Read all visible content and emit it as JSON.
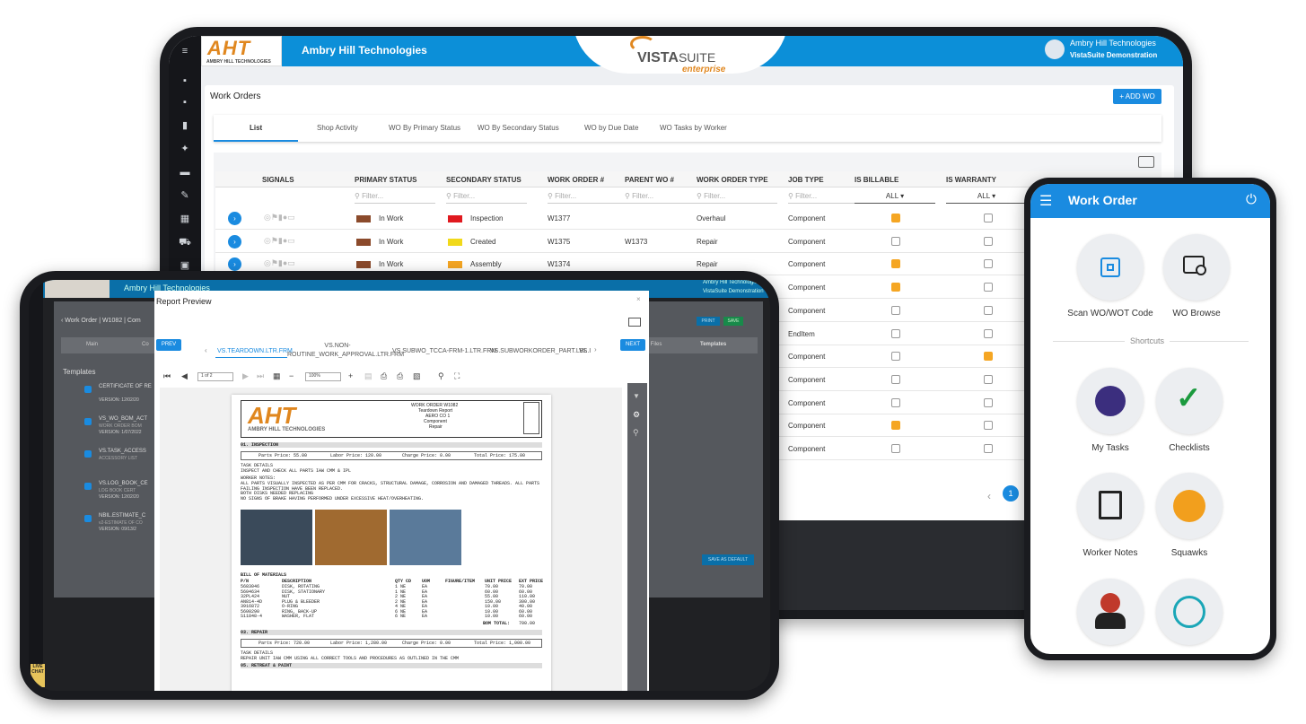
{
  "main": {
    "company": "Ambry Hill Technologies",
    "logo_text": "AHT",
    "logo_sub": "AMBRY HILL TECHNOLOGIES",
    "brand": {
      "vista": "VISTA",
      "suite": "SUITE",
      "enterprise": "enterprise"
    },
    "user": {
      "name": "Ambry Hill Technologies",
      "sub": "VistaSuite Demonstration"
    },
    "page_title": "Work Orders",
    "add_button": "+ ADD WO",
    "tabs": [
      "List",
      "Shop Activity",
      "WO By Primary Status",
      "WO By Secondary Status",
      "WO by Due Date",
      "WO Tasks by Worker"
    ],
    "columns": [
      "SIGNALS",
      "PRIMARY STATUS",
      "SECONDARY STATUS",
      "WORK ORDER #",
      "PARENT WO #",
      "WORK ORDER TYPE",
      "JOB TYPE",
      "IS BILLABLE",
      "IS WARRANTY"
    ],
    "filter_placeholder": "Filter...",
    "all_label": "ALL",
    "rows": [
      {
        "primary": "In Work",
        "secondary": "Inspection",
        "wo": "W1377",
        "parent": "",
        "type": "Overhaul",
        "job": "Component",
        "sec_color": "#e0191f",
        "billable": true,
        "warranty": false
      },
      {
        "primary": "In Work",
        "secondary": "Created",
        "wo": "W1375",
        "parent": "W1373",
        "type": "Repair",
        "job": "Component",
        "sec_color": "#f1d91a",
        "billable": false,
        "warranty": false
      },
      {
        "primary": "In Work",
        "secondary": "Assembly",
        "wo": "W1374",
        "parent": "",
        "type": "Repair",
        "job": "Component",
        "sec_color": "#f5a623",
        "billable": true,
        "warranty": false
      },
      {
        "job": "Component",
        "billable": true,
        "warranty": false
      },
      {
        "job": "Component",
        "billable": false,
        "warranty": false
      },
      {
        "job": "EndItem",
        "billable": false,
        "warranty": false
      },
      {
        "job": "Component",
        "billable": false,
        "warranty": true
      },
      {
        "job": "Component",
        "billable": false,
        "warranty": false
      },
      {
        "job": "Component",
        "billable": false,
        "warranty": false
      },
      {
        "job": "Component",
        "billable": true,
        "warranty": false
      },
      {
        "job": "Component",
        "billable": false,
        "warranty": false
      }
    ],
    "pager": {
      "prev": "‹",
      "page": "1"
    }
  },
  "small": {
    "company": "Ambry Hill Technologies",
    "user": {
      "name": "Ambry Hill Technologies",
      "sub": "VistaSuite Demonstration"
    },
    "breadcrumb": "‹  Work Order | W1082 | Com",
    "print": "PRINT",
    "save": "SAVE",
    "tabs": [
      "Main",
      "Co",
      "ry Files",
      "Templates"
    ],
    "templates_title": "Templates",
    "templates": [
      {
        "name": "CERTIFICATE OF RE",
        "version": "VERSION:",
        "date": "12/02/20"
      },
      {
        "name": "VS_WO_BOM_ACT",
        "sub": "WORK ORDER BOM",
        "version": "VERSION:",
        "date": "1/07/2022"
      },
      {
        "name": "VS.TASK_ACCESS",
        "sub": "ACCESSORY LIST"
      },
      {
        "name": "VS.LOG_BOOK_CE",
        "sub": "LOG BOOK CERT",
        "version": "VERSION:",
        "date": "12/02/20"
      },
      {
        "name": "NBIL.ESTIMATE_C",
        "sub": "v2-ESTIMATE OF CO",
        "version": "VERSION:",
        "date": "09/13/2"
      }
    ],
    "save_default": "SAVE AS DEFAULT",
    "live_chat": "LIVE CHAT"
  },
  "modal": {
    "title": "Report Preview",
    "prev": "PREV",
    "next": "NEXT",
    "links": [
      "VS.TEARDOWN.LTR.FRM",
      "VS.NON-ROUTINE_WORK_APPROVAL.LTR.FRM",
      "VS.SUBWO_TCCA-FRM-1.LTR.FRM",
      "VS.SUBWORKORDER_PART.LBL",
      "VS.I"
    ],
    "page_box": "1 of 2",
    "zoom_box": "100%",
    "report": {
      "title": "WORK ORDER W1082",
      "subtitle": "Teardown Report",
      "model": "AERO CO 1",
      "kind": "Component",
      "type": "Repair",
      "logo": "AHT",
      "logo_sub": "AMBRY HILL TECHNOLOGIES",
      "section1": "01. INSPECTION",
      "parts_price": "Parts Price:",
      "parts_val": "55.00",
      "labor_price": "Labor Price:",
      "labor_val": "120.00",
      "charge_price": "Charge Price:",
      "charge_val": "0.00",
      "total_price": "Total Price:",
      "total_val": "175.00",
      "task_details": "TASK DETAILS",
      "task_text": "INSPECT AND CHECK ALL PARTS IAW CMM & IPL",
      "worker_notes": "WORKER NOTES:",
      "notes": [
        "ALL PARTS VISUALLY INSPECTED AS PER CMM FOR CRACKS, STRUCTURAL DAMAGE, CORROSION AND DAMAGED THREADS.  ALL PARTS",
        "FAILING INSPECTION HAVE BEEN REPLACED.",
        "BOTH DISKS NEEDED REPLACING",
        "NO SIGNS OF BRAKE HAVING PERFORMED UNDER EXCESSIVE HEAT/OVERHEATING."
      ],
      "bom": "BILL OF MATERIALS",
      "bom_cols": [
        "P/N",
        "DESCRIPTION",
        "QTY CD",
        "UOM",
        "FIGURE/ITEM",
        "UNIT PRICE",
        "EXT PRICE"
      ],
      "bom_rows": [
        [
          "5683046",
          "DISK, ROTATING",
          "1 NE",
          "EA",
          "",
          "70.00",
          "70.00"
        ],
        [
          "5604634",
          "DISK, STATIONARY",
          "1 NE",
          "EA",
          "",
          "60.00",
          "60.00"
        ],
        [
          "32PL424",
          "NUT",
          "2 NE",
          "EA",
          "",
          "55.00",
          "110.00"
        ],
        [
          "AN814-4D",
          "PLUG & BLEEDER",
          "2 NE",
          "EA",
          "",
          "150.00",
          "300.00"
        ],
        [
          "3916872",
          "O-RING",
          "4 NE",
          "EA",
          "",
          "10.00",
          "40.00"
        ],
        [
          "5600290",
          "RING, BACK-UP",
          "6 NE",
          "EA",
          "",
          "10.00",
          "60.00"
        ],
        [
          "S11848-4",
          "WASHER, FLAT",
          "6 NE",
          "EA",
          "",
          "10.00",
          "60.00"
        ]
      ],
      "bom_total_label": "BOM TOTAL:",
      "bom_total": "700.00",
      "section2": "03. REPAIR",
      "parts_val2": "720.00",
      "labor_val2": "1,280.00",
      "charge_val2": "0.00",
      "total_val2": "1,000.00",
      "task_text2": "REPAIR UNIT IAW CMM USING ALL CORRECT TOOLS AND PROCEDURES AS OUTLINED IN THE CMM",
      "section3": "05. RETREAT & PAINT"
    }
  },
  "phone": {
    "title": "Work Order",
    "items": [
      "Scan WO/WOT Code",
      "WO Browse"
    ],
    "shortcuts": "Shortcuts",
    "shortcut_items": [
      "My Tasks",
      "Checklists",
      "Worker Notes",
      "Squawks"
    ]
  },
  "colors": {
    "accent": "#1a8be0",
    "brand_orange": "#e0871f",
    "in_work": "#8b4a2b",
    "checkbox_on": "#f5a623",
    "phone_header": "#1a8be0"
  }
}
